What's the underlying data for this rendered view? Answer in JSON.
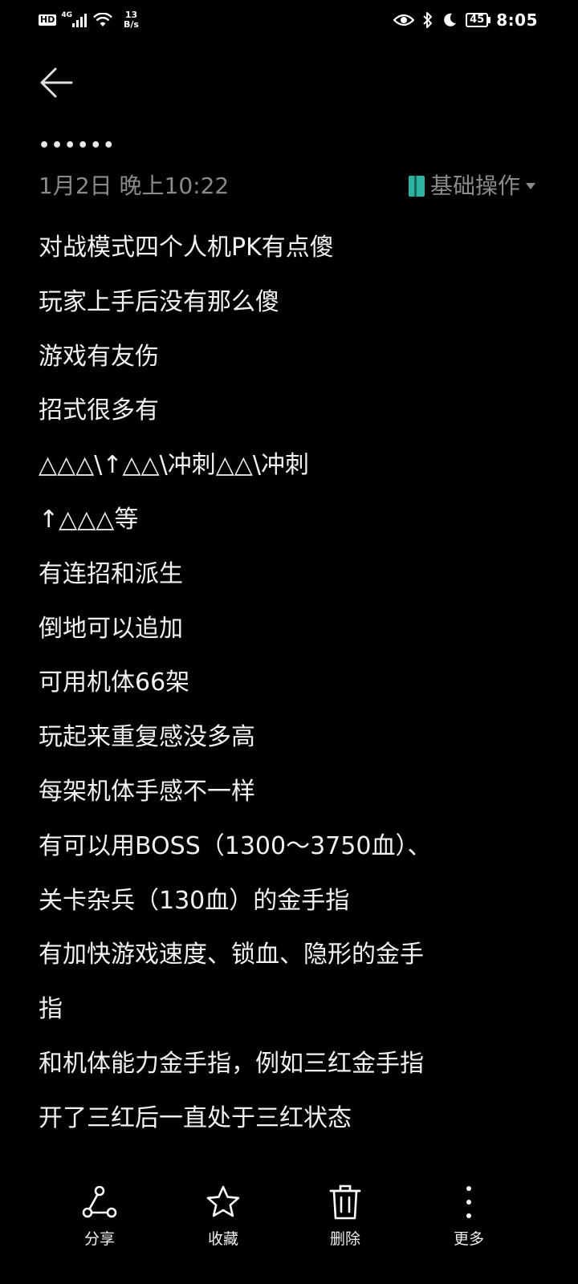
{
  "status_bar": {
    "hd": "HD",
    "network": "4G",
    "speed_value": "13",
    "speed_unit": "B/s",
    "battery": "45",
    "time": "8:05"
  },
  "header": {
    "title": "••••••",
    "date": "1月2日 晚上10:22",
    "folder": "基础操作"
  },
  "content": {
    "lines": [
      "对战模式四个人机PK有点傻",
      "玩家上手后没有那么傻",
      "游戏有友伤",
      "招式很多有",
      "△△△\\↑△△\\冲刺△△\\冲刺",
      "↑△△△等",
      "有连招和派生",
      "倒地可以追加",
      "可用机体66架",
      "玩起来重复感没多高",
      "每架机体手感不一样",
      "有可以用BOSS（1300～3750血）、",
      "关卡杂兵（130血）的金手指",
      "有加快游戏速度、锁血、隐形的金手",
      "指",
      "和机体能力金手指，例如三红金手指",
      "开了三红后一直处于三红状态"
    ]
  },
  "toolbar": {
    "share": "分享",
    "favorite": "收藏",
    "delete": "删除",
    "more": "更多"
  },
  "colors": {
    "background": "#000000",
    "text": "#f2f2f2",
    "muted": "#8a8a8a",
    "folder_icon": "#2bb3a3"
  }
}
